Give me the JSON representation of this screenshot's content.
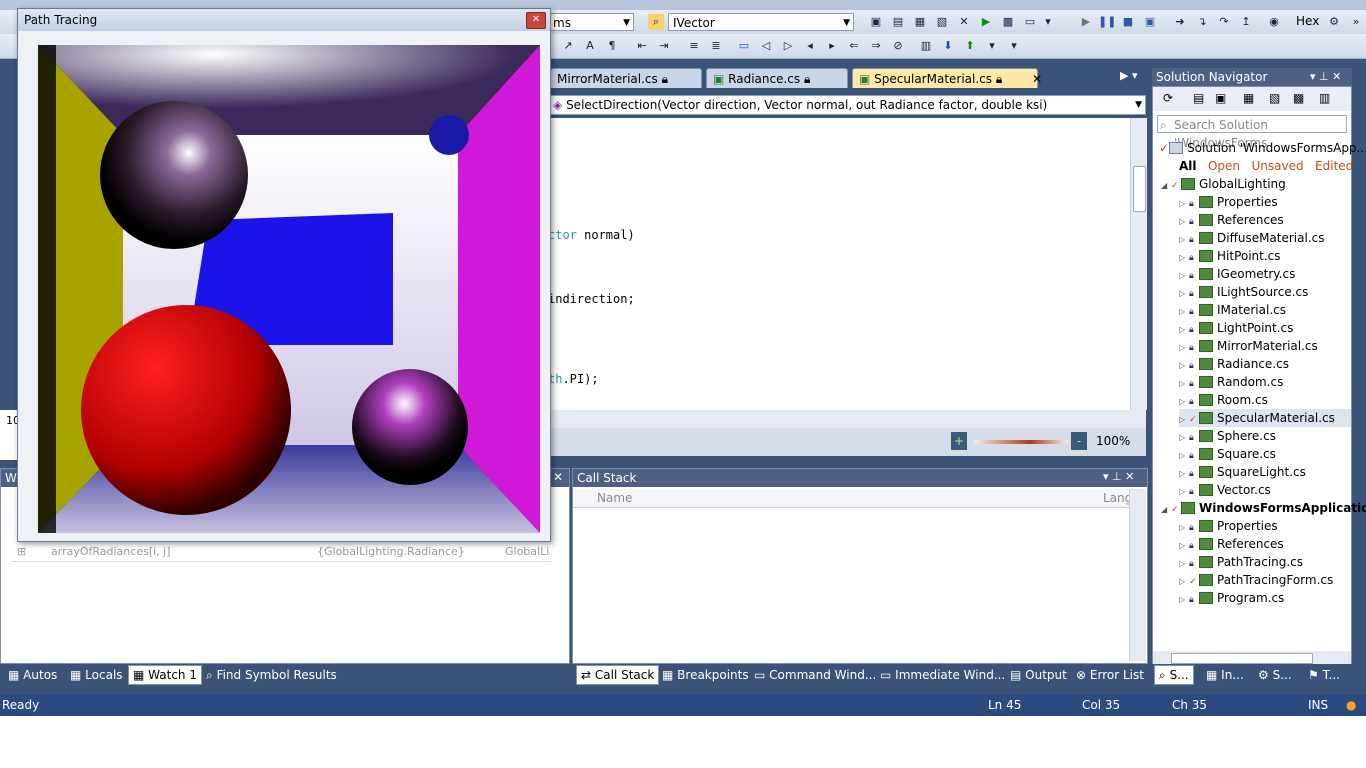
{
  "toolbar": {
    "config_combo": "ms",
    "type_combo": "IVector",
    "hex_label": "Hex"
  },
  "doc_tabs": [
    {
      "label": "MirrorMaterial.cs"
    },
    {
      "label": "Radiance.cs"
    },
    {
      "label": "SpecularMaterial.cs"
    }
  ],
  "member_combo": "SelectDirection(Vector direction, Vector normal, out Radiance factor, double ksi)",
  "code": {
    "line1_kw": "ctor",
    "line1_rest": " normal)",
    "line2": "indirection;",
    "line3_kw": "th",
    "line3_rest": ".PI);"
  },
  "editor": {
    "zoom": "100%",
    "line_number": "10"
  },
  "solution_navigator": {
    "title": "Solution Navigator",
    "search_placeholder": "Search Solution 'WindowsForms",
    "solution_label": "Solution 'WindowsFormsApp...",
    "filters": [
      "All",
      "Open",
      "Unsaved",
      "Edited"
    ],
    "items": [
      {
        "label": "GlobalLighting",
        "level": 1
      },
      {
        "label": "Properties",
        "level": 2
      },
      {
        "label": "References",
        "level": 2
      },
      {
        "label": "DiffuseMaterial.cs",
        "level": 2
      },
      {
        "label": "HitPoint.cs",
        "level": 2
      },
      {
        "label": "IGeometry.cs",
        "level": 2
      },
      {
        "label": "ILightSource.cs",
        "level": 2
      },
      {
        "label": "IMaterial.cs",
        "level": 2
      },
      {
        "label": "LightPoint.cs",
        "level": 2
      },
      {
        "label": "MirrorMaterial.cs",
        "level": 2
      },
      {
        "label": "Radiance.cs",
        "level": 2
      },
      {
        "label": "Random.cs",
        "level": 2
      },
      {
        "label": "Room.cs",
        "level": 2
      },
      {
        "label": "SpecularMaterial.cs",
        "level": 2
      },
      {
        "label": "Sphere.cs",
        "level": 2
      },
      {
        "label": "Square.cs",
        "level": 2
      },
      {
        "label": "SquareLight.cs",
        "level": 2
      },
      {
        "label": "Vector.cs",
        "level": 2
      },
      {
        "label": "WindowsFormsApplication",
        "level": 1
      },
      {
        "label": "Properties",
        "level": 2
      },
      {
        "label": "References",
        "level": 2
      },
      {
        "label": "PathTracing.cs",
        "level": 2
      },
      {
        "label": "PathTracingForm.cs",
        "level": 2
      },
      {
        "label": "Program.cs",
        "level": 2
      }
    ]
  },
  "watch": {
    "title": "W",
    "row_name": "arrayOfRadiances[i, j]",
    "row_value": "{GlobalLighting.Radiance}",
    "row_type": "GlobalLi"
  },
  "call_stack": {
    "title": "Call Stack",
    "col_name": "Name",
    "col_lang": "Lang"
  },
  "bottom_left_tabs": [
    "Autos",
    "Locals",
    "Watch 1",
    "Find Symbol Results"
  ],
  "bottom_right_tabs": [
    "Call Stack",
    "Breakpoints",
    "Command Wind...",
    "Immediate Wind...",
    "Output",
    "Error List"
  ],
  "nav_tabs": [
    "S...",
    "In...",
    "S...",
    "T..."
  ],
  "status": {
    "ready": "Ready",
    "ln": "Ln 45",
    "col": "Col 35",
    "ch": "Ch 35",
    "ins": "INS"
  },
  "path_tracing": {
    "title": "Path Tracing"
  }
}
